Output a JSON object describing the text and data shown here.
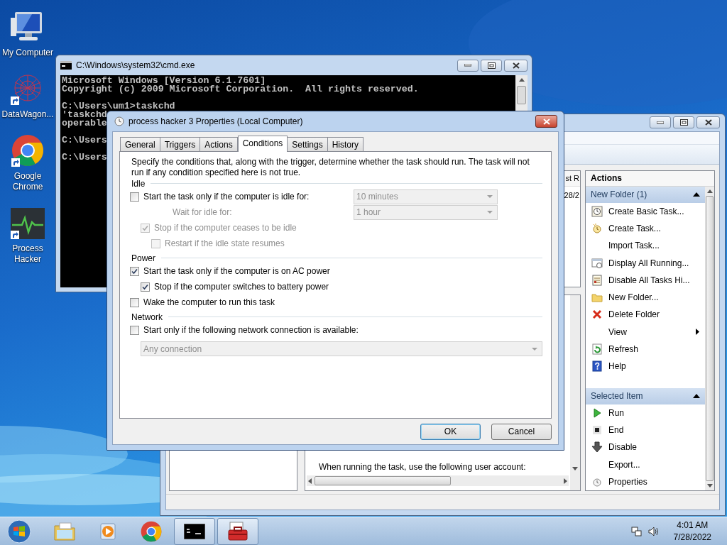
{
  "desktop_icons": [
    {
      "kind": "computer",
      "label": "My Computer",
      "shortcut": false
    },
    {
      "kind": "network-art",
      "label": "DataWagon...",
      "shortcut": true
    },
    {
      "kind": "browser",
      "label": "Google Chrome",
      "shortcut": true
    },
    {
      "kind": "monitor",
      "label": "Process Hacker",
      "shortcut": true
    }
  ],
  "console_window": {
    "title": "C:\\Windows\\system32\\cmd.exe",
    "blocks": [
      [
        "Microsoft Windows [Version 6.1.7601]",
        "Copyright (c) 2009 Microsoft Corporation.  All rights reserved."
      ],
      [
        "C:\\Users\\um1>taskchd",
        "'taskchd",
        "operable"
      ],
      [
        "C:\\Users"
      ],
      [
        "C:\\Users"
      ]
    ]
  },
  "scheduler_window": {
    "list_header": "st R",
    "list_cell": "28/2",
    "actions_title": "Actions",
    "action_groups": [
      {
        "title": "New Folder (1)",
        "items": [
          {
            "kind": "task-wizard",
            "label": "Create Basic Task...",
            "submenu": false
          },
          {
            "kind": "task-new",
            "label": "Create Task...",
            "submenu": false
          },
          {
            "kind": "plain",
            "label": "Import Task...",
            "submenu": false
          },
          {
            "kind": "running",
            "label": "Display All Running...",
            "submenu": false
          },
          {
            "kind": "disable-all",
            "label": "Disable All Tasks Hi...",
            "submenu": false
          },
          {
            "kind": "folder",
            "label": "New Folder...",
            "submenu": false
          },
          {
            "kind": "delete",
            "label": "Delete Folder",
            "submenu": false
          },
          {
            "kind": "plain",
            "label": "View",
            "submenu": true
          },
          {
            "kind": "refresh",
            "label": "Refresh",
            "submenu": false
          },
          {
            "kind": "help",
            "label": "Help",
            "submenu": false
          }
        ]
      },
      {
        "title": "Selected Item",
        "items": [
          {
            "kind": "run",
            "label": "Run",
            "submenu": false
          },
          {
            "kind": "end",
            "label": "End",
            "submenu": false
          },
          {
            "kind": "disable",
            "label": "Disable",
            "submenu": false
          },
          {
            "kind": "plain",
            "label": "Export...",
            "submenu": false
          },
          {
            "kind": "properties",
            "label": "Properties",
            "submenu": false
          }
        ]
      }
    ],
    "details_text": "When running the task, use the following user account:"
  },
  "dialog": {
    "title": "process hacker 3 Properties (Local Computer)",
    "tabs": [
      {
        "label": "General",
        "selected": false
      },
      {
        "label": "Triggers",
        "selected": false
      },
      {
        "label": "Actions",
        "selected": false
      },
      {
        "label": "Conditions",
        "selected": true
      },
      {
        "label": "Settings",
        "selected": false
      },
      {
        "label": "History",
        "selected": false
      }
    ],
    "description": "Specify the conditions that, along with the trigger, determine whether the task should run.  The task will not run  if any condition specified here is not true.",
    "sections": [
      {
        "title": "Idle",
        "rows": [
          {
            "kind": "checkbox",
            "label": "Start the task only if the computer is idle for:",
            "checked": false,
            "disabled": false,
            "select": {
              "value": "10 minutes",
              "disabled": true
            },
            "children": [
              {
                "kind": "field",
                "label": "Wait for idle for:",
                "disabled": true,
                "select": {
                  "value": "1 hour",
                  "disabled": true
                }
              },
              {
                "kind": "checkbox",
                "label": "Stop if the computer ceases to be idle",
                "checked": true,
                "disabled": true,
                "children": [
                  {
                    "kind": "checkbox",
                    "label": "Restart if the idle state resumes",
                    "checked": false,
                    "disabled": true
                  }
                ]
              }
            ]
          }
        ]
      },
      {
        "title": "Power",
        "rows": [
          {
            "kind": "checkbox",
            "label": "Start the task only if the computer is on AC power",
            "checked": true,
            "disabled": false,
            "children": [
              {
                "kind": "checkbox",
                "label": "Stop if the computer switches to battery power",
                "checked": true,
                "disabled": false
              }
            ]
          },
          {
            "kind": "checkbox",
            "label": "Wake the computer to run this task",
            "checked": false,
            "disabled": false
          }
        ]
      },
      {
        "title": "Network",
        "rows": [
          {
            "kind": "checkbox",
            "label": "Start only if the following network connection is available:",
            "checked": false,
            "disabled": false,
            "children": [
              {
                "kind": "select",
                "select": {
                  "value": "Any connection",
                  "disabled": true
                }
              }
            ]
          }
        ]
      }
    ],
    "buttons": [
      {
        "label": "OK",
        "default": true
      },
      {
        "label": "Cancel",
        "default": false
      }
    ]
  },
  "taskbar": {
    "buttons": [
      {
        "kind": "folders",
        "active": false
      },
      {
        "kind": "media",
        "active": false
      },
      {
        "kind": "browser",
        "active": false
      },
      {
        "kind": "console",
        "active": true
      },
      {
        "kind": "toolbox",
        "active": true
      }
    ],
    "time": "4:01 AM",
    "date": "7/28/2022"
  }
}
